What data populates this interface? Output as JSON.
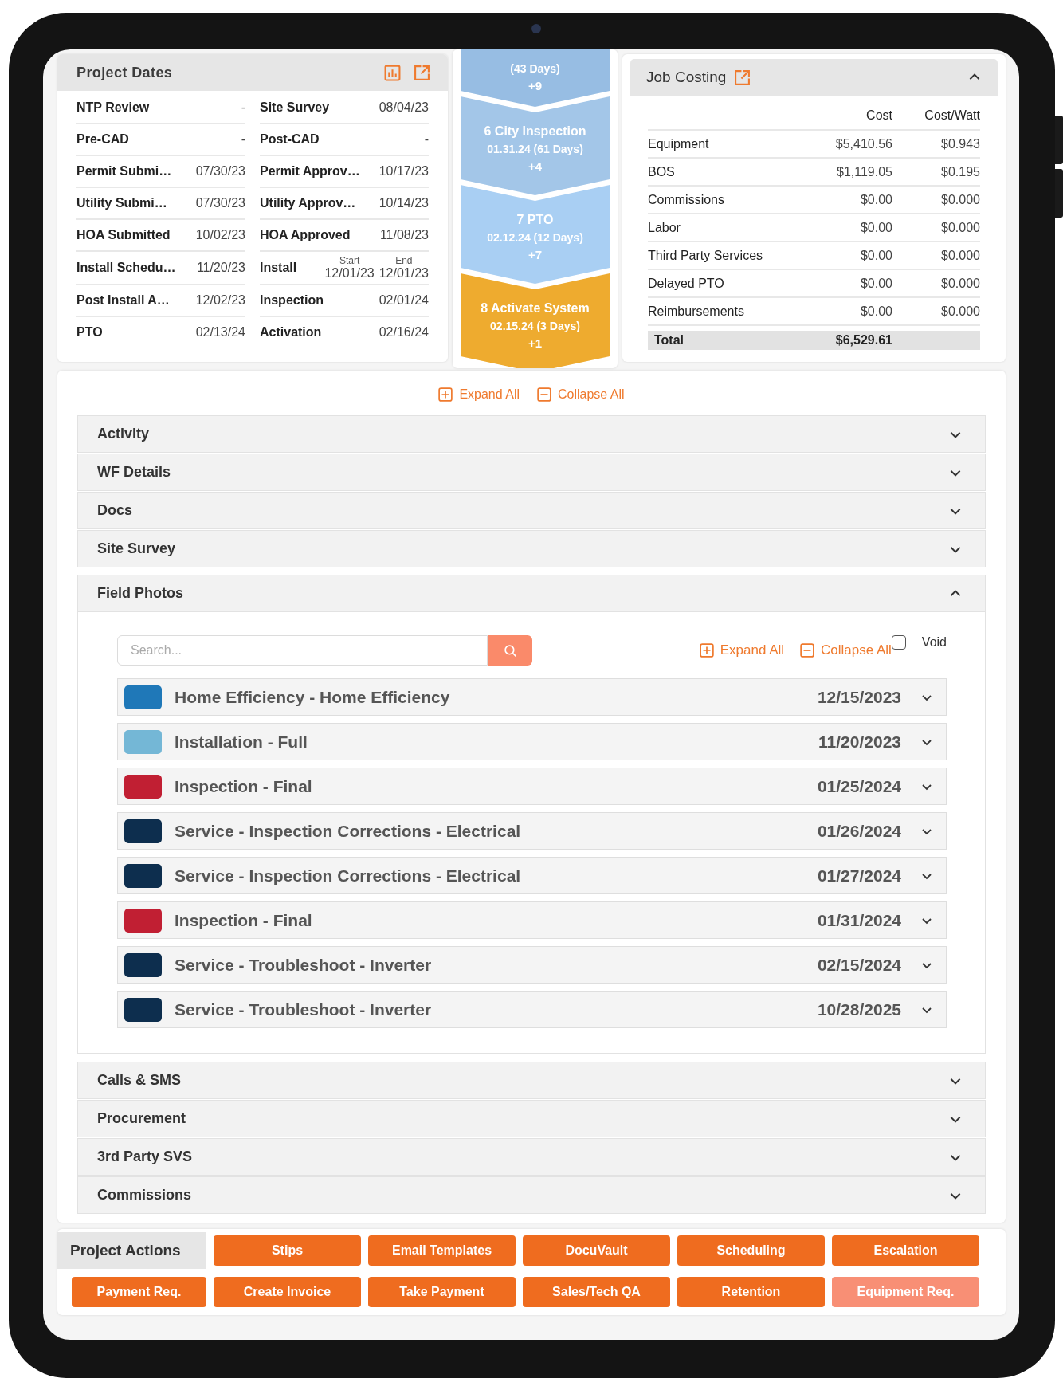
{
  "project_dates": {
    "title": "Project Dates",
    "rows": [
      [
        {
          "kind": "single",
          "label": "NTP Review",
          "value": "-"
        },
        {
          "kind": "single",
          "label": "Site Survey",
          "value": "08/04/23"
        }
      ],
      [
        {
          "kind": "single",
          "label": "Pre-CAD",
          "value": "-"
        },
        {
          "kind": "single",
          "label": "Post-CAD",
          "value": "-"
        }
      ],
      [
        {
          "kind": "single",
          "label": "Permit Submi…",
          "value": "07/30/23"
        },
        {
          "kind": "single",
          "label": "Permit Approv…",
          "value": "10/17/23"
        }
      ],
      [
        {
          "kind": "single",
          "label": "Utility Submi…",
          "value": "07/30/23"
        },
        {
          "kind": "single",
          "label": "Utility Approv…",
          "value": "10/14/23"
        }
      ],
      [
        {
          "kind": "single",
          "label": "HOA Submitted",
          "value": "10/02/23"
        },
        {
          "kind": "single",
          "label": "HOA Approved",
          "value": "11/08/23"
        }
      ],
      [
        {
          "kind": "single",
          "label": "Install Schedu…",
          "value": "11/20/23"
        },
        {
          "kind": "range",
          "label": "Install",
          "start_label": "Start",
          "start": "12/01/23",
          "end_label": "End",
          "end": "12/01/23"
        }
      ],
      [
        {
          "kind": "single",
          "label": "Post Install A…",
          "value": "12/02/23"
        },
        {
          "kind": "single",
          "label": "Inspection",
          "value": "02/01/24"
        }
      ],
      [
        {
          "kind": "single",
          "label": "PTO",
          "value": "02/13/24"
        },
        {
          "kind": "single",
          "label": "Activation",
          "value": "02/16/24"
        }
      ]
    ]
  },
  "milestones": [
    {
      "lines": [
        "(43 Days)"
      ],
      "delta": "+9",
      "color": "#97bde3"
    },
    {
      "lines": [
        "6 City Inspection",
        "01.31.24 (61 Days)"
      ],
      "delta": "+4",
      "color": "#a3c6e8"
    },
    {
      "lines": [
        "7 PTO",
        "02.12.24 (12 Days)"
      ],
      "delta": "+7",
      "color": "#a9cff3"
    },
    {
      "lines": [
        "8 Activate System",
        "02.15.24 (3 Days)"
      ],
      "delta": "+1",
      "color": "#eeab2f"
    }
  ],
  "job_costing": {
    "title": "Job Costing",
    "expanded": true,
    "columns": [
      "Cost",
      "Cost/Watt"
    ],
    "rows": [
      {
        "label": "Equipment",
        "cost": "$5,410.56",
        "per_watt": "$0.943"
      },
      {
        "label": "BOS",
        "cost": "$1,119.05",
        "per_watt": "$0.195"
      },
      {
        "label": "Commissions",
        "cost": "$0.00",
        "per_watt": "$0.000"
      },
      {
        "label": "Labor",
        "cost": "$0.00",
        "per_watt": "$0.000"
      },
      {
        "label": "Third Party Services",
        "cost": "$0.00",
        "per_watt": "$0.000"
      },
      {
        "label": "Delayed PTO",
        "cost": "$0.00",
        "per_watt": "$0.000"
      },
      {
        "label": "Reimbursements",
        "cost": "$0.00",
        "per_watt": "$0.000"
      }
    ],
    "total": {
      "label": "Total",
      "cost": "$6,529.61"
    }
  },
  "expand_all": "Expand All",
  "collapse_all": "Collapse All",
  "sections": [
    {
      "title": "Activity",
      "expanded": false
    },
    {
      "title": "WF Details",
      "expanded": false
    },
    {
      "title": "Docs",
      "expanded": false
    },
    {
      "title": "Site Survey",
      "expanded": false
    },
    {
      "title": "Field Photos",
      "expanded": true
    },
    {
      "title": "Calls & SMS",
      "expanded": false
    },
    {
      "title": "Procurement",
      "expanded": false
    },
    {
      "title": "3rd Party SVS",
      "expanded": false
    },
    {
      "title": "Commissions",
      "expanded": false
    }
  ],
  "field_photos": {
    "search": {
      "placeholder": "Search..."
    },
    "expand_all": "Expand All",
    "collapse_all": "Collapse All",
    "void": {
      "label": "Void",
      "checked": false
    },
    "items": [
      {
        "title": "Home Efficiency - Home Efficiency",
        "date": "12/15/2023",
        "color": "#1f78b8"
      },
      {
        "title": "Installation - Full",
        "date": "11/20/2023",
        "color": "#74b7d6"
      },
      {
        "title": "Inspection - Final",
        "date": "01/25/2024",
        "color": "#c11f33"
      },
      {
        "title": "Service - Inspection Corrections - Electrical",
        "date": "01/26/2024",
        "color": "#0d2e4e"
      },
      {
        "title": "Service - Inspection Corrections - Electrical",
        "date": "01/27/2024",
        "color": "#0d2e4e"
      },
      {
        "title": "Inspection - Final",
        "date": "01/31/2024",
        "color": "#c11f33"
      },
      {
        "title": "Service - Troubleshoot - Inverter",
        "date": "02/15/2024",
        "color": "#0d2e4e"
      },
      {
        "title": "Service - Troubleshoot - Inverter",
        "date": "10/28/2025",
        "color": "#0d2e4e"
      }
    ]
  },
  "project_actions": {
    "title": "Project Actions",
    "buttons": [
      {
        "label": "Stips",
        "disabled": false
      },
      {
        "label": "Email Templates",
        "disabled": false
      },
      {
        "label": "DocuVault",
        "disabled": false
      },
      {
        "label": "Scheduling",
        "disabled": false
      },
      {
        "label": "Escalation",
        "disabled": false
      },
      {
        "label": "Payment Req.",
        "disabled": false
      },
      {
        "label": "Create Invoice",
        "disabled": false
      },
      {
        "label": "Take Payment",
        "disabled": false
      },
      {
        "label": "Sales/Tech QA",
        "disabled": false
      },
      {
        "label": "Retention",
        "disabled": false
      },
      {
        "label": "Equipment Req.",
        "disabled": true
      }
    ]
  }
}
